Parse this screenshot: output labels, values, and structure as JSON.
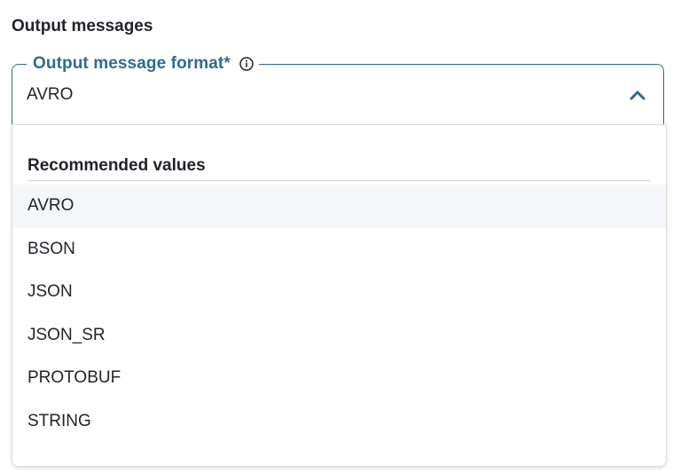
{
  "section": {
    "title": "Output messages"
  },
  "field": {
    "label": "Output message format*",
    "value": "AVRO",
    "expanded": true
  },
  "dropdown": {
    "group_label": "Recommended values",
    "options": [
      {
        "label": "AVRO",
        "highlighted": true
      },
      {
        "label": "BSON",
        "highlighted": false
      },
      {
        "label": "JSON",
        "highlighted": false
      },
      {
        "label": "JSON_SR",
        "highlighted": false
      },
      {
        "label": "PROTOBUF",
        "highlighted": false
      },
      {
        "label": "STRING",
        "highlighted": false
      }
    ]
  },
  "colors": {
    "accent": "#2f6b93",
    "text": "#1f2329",
    "highlight_bg": "#f5f6f7",
    "border": "#d9dde2"
  },
  "icons": {
    "info": "info-circle-icon",
    "toggle": "chevron-up-icon"
  }
}
